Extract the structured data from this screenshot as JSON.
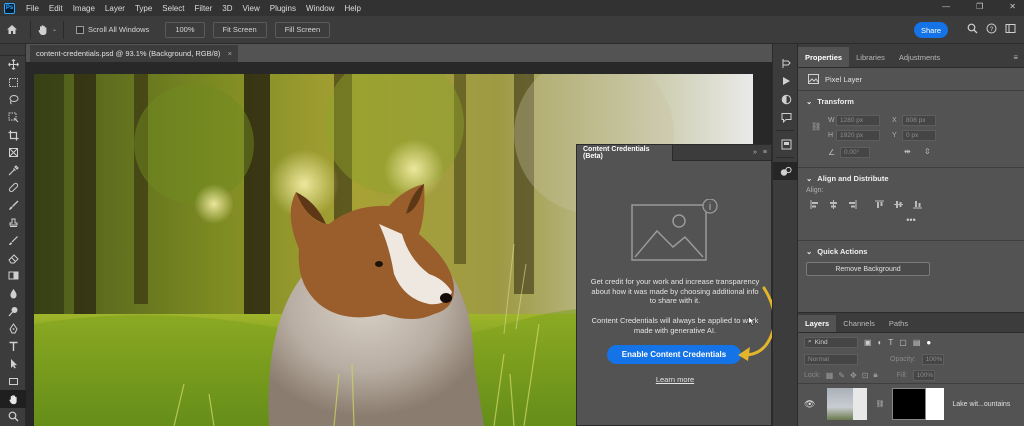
{
  "app": {
    "logo_text": "Ps"
  },
  "menu": [
    "File",
    "Edit",
    "Image",
    "Layer",
    "Type",
    "Select",
    "Filter",
    "3D",
    "View",
    "Plugins",
    "Window",
    "Help"
  ],
  "options_bar": {
    "scroll_all_windows": "Scroll All Windows",
    "zoom_value": "100%",
    "fit_screen": "Fit Screen",
    "fill_screen": "Fill Screen",
    "share": "Share"
  },
  "document_tab": {
    "title": "content-credentials.psd @ 93.1% (Background, RGB/8)",
    "close": "×"
  },
  "cc_panel": {
    "tab_title": "Content Credentials (Beta)",
    "description": "Get credit for your work and increase transparency about how it was made by choosing additional info to share with it.",
    "note": "Content Credentials will always be applied to work made with generative AI.",
    "enable_button": "Enable Content Credentials",
    "learn_more": "Learn more"
  },
  "right_panel": {
    "tabs": [
      "Properties",
      "Libraries",
      "Adjustments"
    ],
    "layer_type": "Pixel Layer",
    "transform": {
      "title": "Transform",
      "w": "1280 px",
      "h": "1920 px",
      "x": "808 px",
      "y": "0 px",
      "angle": "0.00°"
    },
    "align": {
      "title": "Align and Distribute",
      "label": "Align:"
    },
    "quick_actions": {
      "title": "Quick Actions",
      "remove_bg": "Remove Background"
    }
  },
  "layers_panel": {
    "tabs": [
      "Layers",
      "Channels",
      "Paths"
    ],
    "filter": "Kind",
    "blend_mode": "Normal",
    "opacity_label": "Opacity:",
    "opacity_value": "100%",
    "lock_label": "Lock:",
    "fill_label": "Fill:",
    "fill_value": "100%",
    "layer_name": "Lake wit...ountains"
  },
  "colors": {
    "accent": "#1473e6",
    "arrow": "#e2b52a"
  }
}
